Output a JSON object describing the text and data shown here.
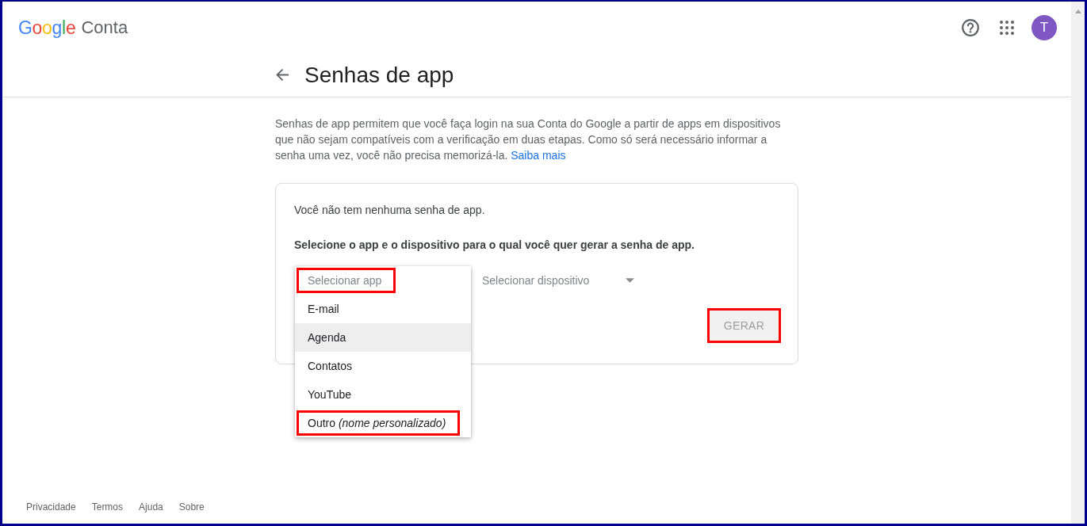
{
  "header": {
    "logo": {
      "brand": "Google",
      "product": "Conta"
    },
    "avatar": {
      "initial": "T"
    }
  },
  "page": {
    "title": "Senhas de app",
    "description": {
      "text": "Senhas de app permitem que você faça login na sua Conta do Google a partir de apps em dispositivos que não sejam compatíveis com a verificação em duas etapas. Como só será necessário informar a senha uma vez, você não precisa memorizá-la.",
      "link": "Saiba mais"
    }
  },
  "card": {
    "status": "Você não tem nenhuma senha de app.",
    "instruction": "Selecione o app e o dispositivo para o qual você quer gerar a senha de app.",
    "app_menu": {
      "expanded": true,
      "items": [
        {
          "label": "Selecionar app",
          "kind": "placeholder",
          "selected": false,
          "marked": true
        },
        {
          "label": "E-mail",
          "kind": "option",
          "selected": false,
          "marked": false
        },
        {
          "label": "Agenda",
          "kind": "option",
          "selected": true,
          "marked": false
        },
        {
          "label": "Contatos",
          "kind": "option",
          "selected": false,
          "marked": false
        },
        {
          "label": "YouTube",
          "kind": "option",
          "selected": false,
          "marked": false
        },
        {
          "label": "Outro *(nome personalizado)*",
          "kind": "option",
          "selected": false,
          "marked": true
        }
      ]
    },
    "device_select": {
      "placeholder": "Selecionar dispositivo"
    },
    "generate_button": {
      "label": "GERAR",
      "disabled": true,
      "marked": true
    }
  },
  "footer": {
    "links": [
      "Privacidade",
      "Termos",
      "Ajuda",
      "Sobre"
    ]
  }
}
